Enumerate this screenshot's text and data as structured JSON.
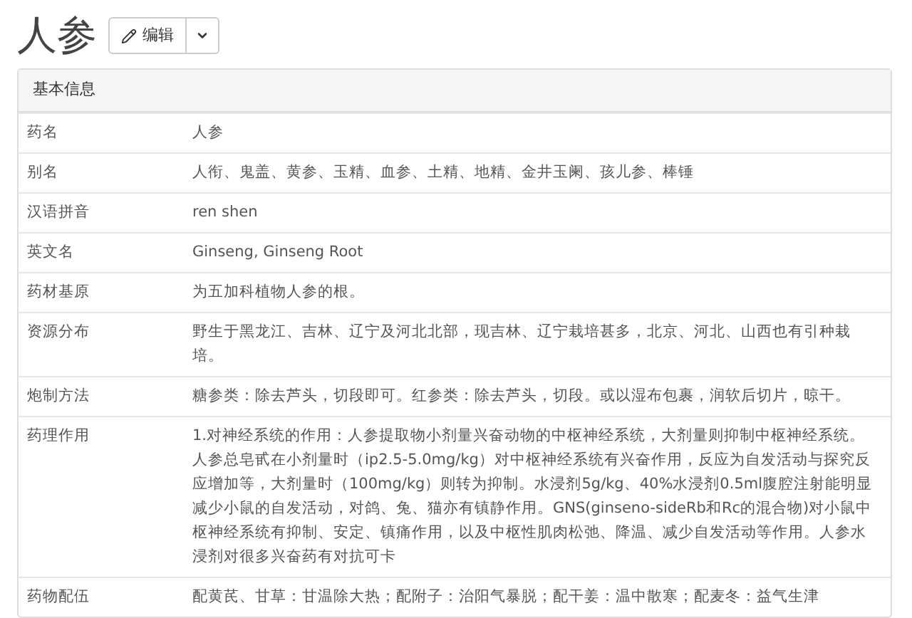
{
  "title": "人参",
  "edit_button": {
    "label": "编辑"
  },
  "panel": {
    "heading": "基本信息",
    "rows": [
      {
        "label": "药名",
        "value": "人参"
      },
      {
        "label": "别名",
        "value": "人衔、鬼盖、黄参、玉精、血参、土精、地精、金井玉阑、孩儿参、棒锤"
      },
      {
        "label": "汉语拼音",
        "value": "ren shen"
      },
      {
        "label": "英文名",
        "value": "Ginseng, Ginseng Root"
      },
      {
        "label": "药材基原",
        "value": "为五加科植物人参的根。"
      },
      {
        "label": "资源分布",
        "value": "野生于黑龙江、吉林、辽宁及河北北部，现吉林、辽宁栽培甚多，北京、河北、山西也有引种栽培。"
      },
      {
        "label": "炮制方法",
        "value": "糖参类：除去芦头，切段即可。红参类：除去芦头，切段。或以湿布包裹，润软后切片，晾干。"
      },
      {
        "label": "药理作用",
        "value": "1.对神经系统的作用：人参提取物小剂量兴奋动物的中枢神经系统，大剂量则抑制中枢神经系统。人参总皂甙在小剂量时（ip2.5-5.0mg/kg）对中枢神经系统有兴奋作用，反应为自发活动与探究反应增加等，大剂量时（100mg/kg）则转为抑制。水浸剂5g/kg、40%水浸剂0.5ml腹腔注射能明显减少小鼠的自发活动，对鸽、兔、猫亦有镇静作用。GNS(ginseno-sideRb和Rc的混合物)对小鼠中枢神经系统有抑制、安定、镇痛作用，以及中枢性肌肉松弛、降温、减少自发活动等作用。人参水浸剂对很多兴奋药有对抗可卡"
      },
      {
        "label": "药物配伍",
        "value": "配黄芪、甘草：甘温除大热；配附子：治阳气暴脱；配干姜：温中散寒；配麦冬：益气生津"
      }
    ]
  }
}
